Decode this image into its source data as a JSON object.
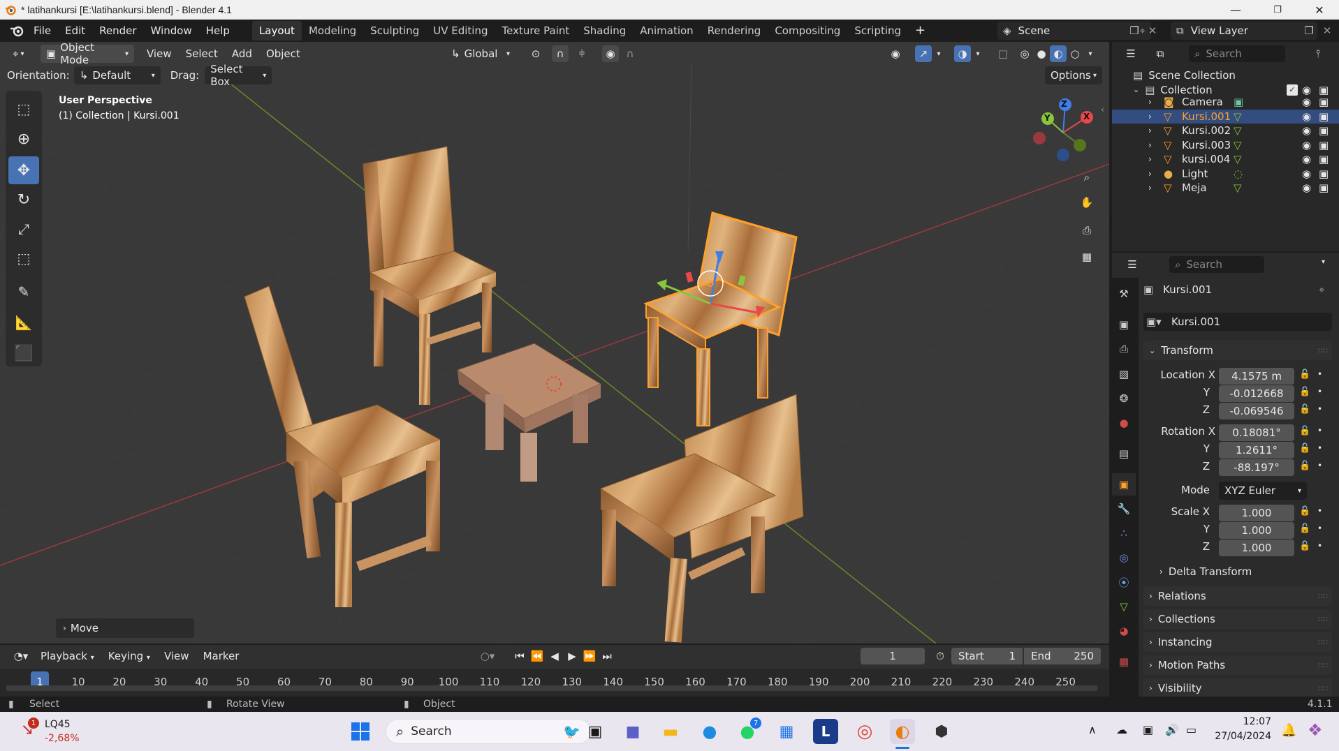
{
  "window": {
    "title": "* latihankursi [E:\\latihankursi.blend] - Blender 4.1"
  },
  "menu": [
    "File",
    "Edit",
    "Render",
    "Window",
    "Help"
  ],
  "workspaces": [
    "Layout",
    "Modeling",
    "Sculpting",
    "UV Editing",
    "Texture Paint",
    "Shading",
    "Animation",
    "Rendering",
    "Compositing",
    "Scripting"
  ],
  "active_workspace": "Layout",
  "scene": "Scene",
  "view_layer": "View Layer",
  "viewport_header": {
    "mode": "Object Mode",
    "menus": [
      "View",
      "Select",
      "Add",
      "Object"
    ],
    "transform_orientation": "Global"
  },
  "tool_settings": {
    "orientation_label": "Orientation:",
    "orientation_value": "Default",
    "drag_label": "Drag:",
    "drag_value": "Select Box",
    "options_label": "Options"
  },
  "viewport_info": {
    "line1": "User Perspective",
    "line2": "(1) Collection | Kursi.001"
  },
  "gizmo_axes": {
    "x": "X",
    "y": "Y",
    "z": "Z"
  },
  "last_operator": "Move",
  "outliner": {
    "search_placeholder": "Search",
    "scene_collection": "Scene Collection",
    "collection": "Collection",
    "items": [
      {
        "name": "Camera",
        "type": "camera"
      },
      {
        "name": "Kursi.001",
        "type": "mesh",
        "selected": true
      },
      {
        "name": "Kursi.002",
        "type": "mesh"
      },
      {
        "name": "Kursi.003",
        "type": "mesh"
      },
      {
        "name": "kursi.004",
        "type": "mesh"
      },
      {
        "name": "Light",
        "type": "light"
      },
      {
        "name": "Meja",
        "type": "mesh"
      }
    ]
  },
  "properties": {
    "search_placeholder": "Search",
    "object_title": "Kursi.001",
    "object_name": "Kursi.001",
    "transform_label": "Transform",
    "location": {
      "label": "Location X",
      "x": "4.1575 m",
      "y": "-0.012668",
      "z": "-0.069546"
    },
    "rotation": {
      "label": "Rotation X",
      "x": "0.18081°",
      "y": "1.2611°",
      "z": "-88.197°"
    },
    "mode_label": "Mode",
    "mode_value": "XYZ Euler",
    "scale": {
      "label": "Scale X",
      "x": "1.000",
      "y": "1.000",
      "z": "1.000"
    },
    "axis_y": "Y",
    "axis_z": "Z",
    "delta_transform": "Delta Transform",
    "panels": [
      "Relations",
      "Collections",
      "Instancing",
      "Motion Paths",
      "Visibility"
    ]
  },
  "timeline": {
    "menus": [
      "Playback",
      "Keying",
      "View",
      "Marker"
    ],
    "current_frame": "1",
    "start_label": "Start",
    "start_value": "1",
    "end_label": "End",
    "end_value": "250",
    "ruler": [
      "1",
      "10",
      "20",
      "30",
      "40",
      "50",
      "60",
      "70",
      "80",
      "90",
      "100",
      "110",
      "120",
      "130",
      "140",
      "150",
      "160",
      "170",
      "180",
      "190",
      "200",
      "210",
      "220",
      "230",
      "240",
      "250"
    ]
  },
  "statusbar": {
    "left": "Select",
    "middle": "Rotate View",
    "right": "Object",
    "version": "4.1.1"
  },
  "taskbar": {
    "stock_name": "LQ45",
    "stock_change": "-2,68%",
    "search_label": "Search",
    "time": "12:07",
    "date": "27/04/2024",
    "badge_whatsapp": "7",
    "badge_stock": "1"
  },
  "colors": {
    "accent": "#4772b3",
    "selected_orange": "#ffa02c",
    "axis_x": "#e8484a",
    "axis_y": "#8ac53e",
    "axis_z": "#3f7ee6"
  }
}
